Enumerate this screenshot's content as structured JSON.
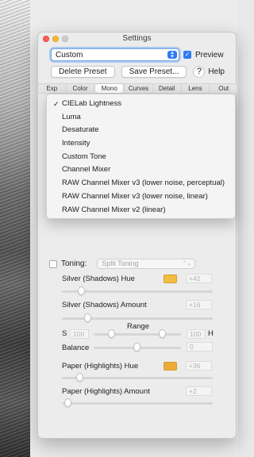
{
  "window": {
    "title": "Settings"
  },
  "toolbar": {
    "preset_value": "Custom",
    "preview_label": "Preview",
    "delete_preset_label": "Delete Preset",
    "save_preset_label": "Save Preset...",
    "help_symbol": "?",
    "help_label": "Help"
  },
  "tabs": [
    "Exp",
    "Color",
    "Mono",
    "Curves",
    "Detail",
    "Lens",
    "Out"
  ],
  "active_tab": "Mono",
  "mono_method_menu": {
    "selected": "CIELab Lightness",
    "items": [
      "CIELab Lightness",
      "Luma",
      "Desaturate",
      "Intensity",
      "Custom Tone",
      "Channel Mixer",
      "RAW Channel Mixer v3 (lower noise, perceptual)",
      "RAW Channel Mixer v3 (lower noise, linear)",
      "RAW Channel Mixer v2 (linear)"
    ]
  },
  "toning": {
    "label": "Toning:",
    "mode": "Split Toning",
    "silver_hue_label": "Silver (Shadows) Hue",
    "silver_hue_value": "+42",
    "silver_hue_color": "#f3bd3f",
    "silver_amount_label": "Silver (Shadows) Amount",
    "silver_amount_value": "+16",
    "range_label": "Range",
    "range_s_label": "S",
    "range_s_value": "100",
    "range_h_label": "H",
    "range_h_value": "100",
    "balance_label": "Balance",
    "balance_value": "0",
    "paper_hue_label": "Paper (Highlights) Hue",
    "paper_hue_value": "+36",
    "paper_hue_color": "#efab3a",
    "paper_amount_label": "Paper (Highlights) Amount",
    "paper_amount_value": "+2"
  },
  "colors": {
    "accent": "#2f7bf5"
  }
}
